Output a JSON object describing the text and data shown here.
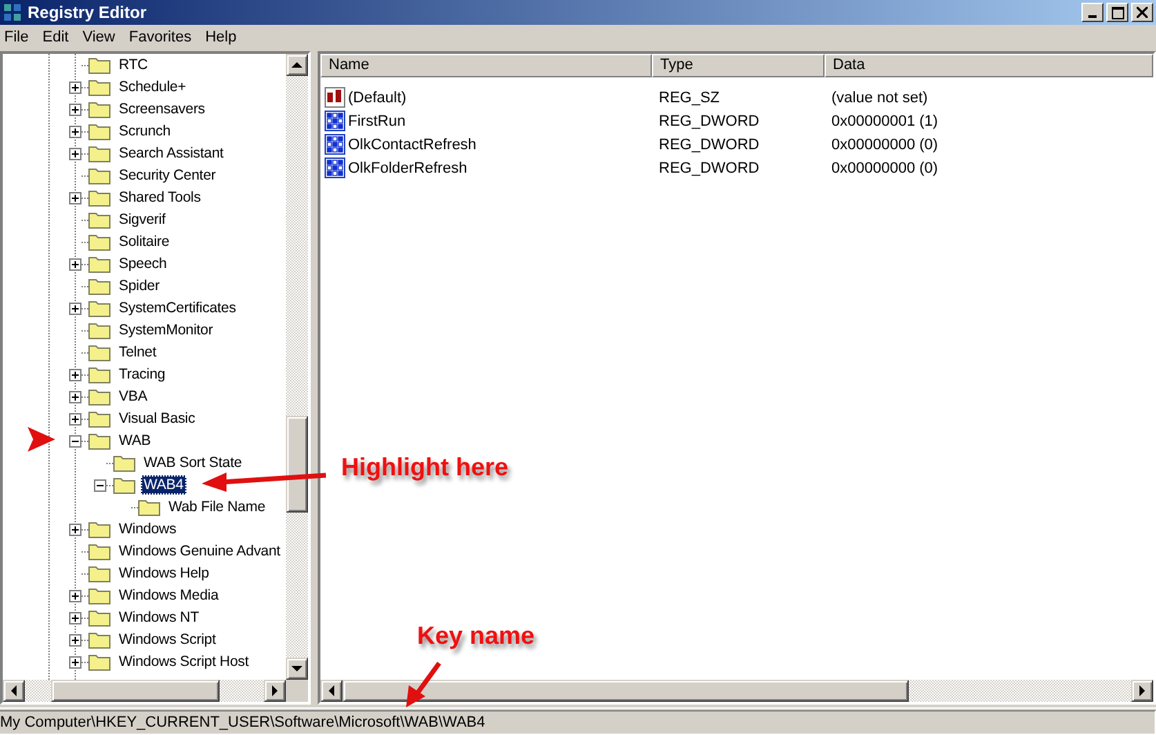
{
  "window": {
    "title": "Registry Editor"
  },
  "menu": [
    "File",
    "Edit",
    "View",
    "Favorites",
    "Help"
  ],
  "tree": [
    {
      "label": "RTC",
      "selected": false
    },
    {
      "label": "Schedule+",
      "expanded": false,
      "selected": false
    },
    {
      "label": "Screensavers",
      "expanded": false,
      "selected": false
    },
    {
      "label": "Scrunch",
      "expanded": false,
      "selected": false
    },
    {
      "label": "Search Assistant",
      "expanded": false,
      "selected": false
    },
    {
      "label": "Security Center",
      "selected": false
    },
    {
      "label": "Shared Tools",
      "expanded": false,
      "selected": false
    },
    {
      "label": "Sigverif",
      "selected": false
    },
    {
      "label": "Solitaire",
      "selected": false
    },
    {
      "label": "Speech",
      "expanded": false,
      "selected": false
    },
    {
      "label": "Spider",
      "selected": false
    },
    {
      "label": "SystemCertificates",
      "expanded": false,
      "selected": false
    },
    {
      "label": "SystemMonitor",
      "selected": false
    },
    {
      "label": "Telnet",
      "selected": false
    },
    {
      "label": "Tracing",
      "expanded": false,
      "selected": false
    },
    {
      "label": "VBA",
      "expanded": false,
      "selected": false
    },
    {
      "label": "Visual Basic",
      "expanded": false,
      "selected": false
    },
    {
      "label": "WAB",
      "expanded": true,
      "selected": false,
      "children": [
        {
          "label": "WAB Sort State",
          "selected": false
        },
        {
          "label": "WAB4",
          "expanded": true,
          "selected": true,
          "children": [
            {
              "label": "Wab File Name",
              "selected": false
            }
          ]
        }
      ]
    },
    {
      "label": "Windows",
      "expanded": false,
      "selected": false
    },
    {
      "label": "Windows Genuine Advant",
      "selected": false
    },
    {
      "label": "Windows Help",
      "selected": false
    },
    {
      "label": "Windows Media",
      "expanded": false,
      "selected": false
    },
    {
      "label": "Windows NT",
      "expanded": false,
      "selected": false
    },
    {
      "label": "Windows Script",
      "expanded": false,
      "selected": false
    },
    {
      "label": "Windows Script Host",
      "expanded": false,
      "selected": false
    }
  ],
  "values": {
    "columns": [
      "Name",
      "Type",
      "Data"
    ],
    "rows": [
      {
        "kind": "string",
        "name": "(Default)",
        "type": "REG_SZ",
        "data": "(value not set)"
      },
      {
        "kind": "dword",
        "name": "FirstRun",
        "type": "REG_DWORD",
        "data": "0x00000001 (1)"
      },
      {
        "kind": "dword",
        "name": "OlkContactRefresh",
        "type": "REG_DWORD",
        "data": "0x00000000 (0)"
      },
      {
        "kind": "dword",
        "name": "OlkFolderRefresh",
        "type": "REG_DWORD",
        "data": "0x00000000 (0)"
      }
    ]
  },
  "status_bar": "My Computer\\HKEY_CURRENT_USER\\Software\\Microsoft\\WAB\\WAB4",
  "annotations": [
    {
      "kind": "marker"
    },
    {
      "kind": "callout-left",
      "text": "Highlight here"
    },
    {
      "kind": "callout-down",
      "text": "Key name"
    }
  ]
}
